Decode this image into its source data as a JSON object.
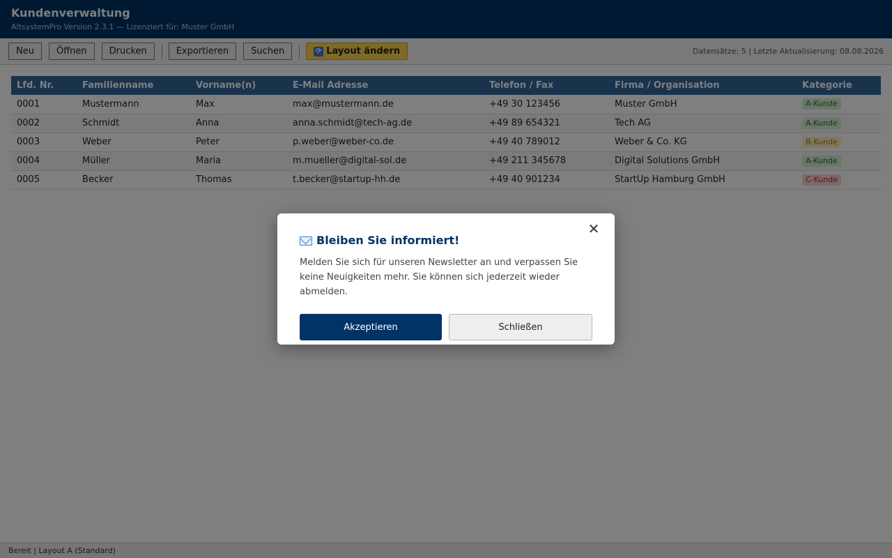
{
  "app": {
    "title": "Kundenverwaltung",
    "subtitle": "AltsystemPro Version 2.3.1 — Lizenziert für: Muster GmbH"
  },
  "toolbar": {
    "new_label": "Neu",
    "open_label": "Öffnen",
    "print_label": "Drucken",
    "export_label": "Exportieren",
    "search_label": "Suchen",
    "layout_label": "Layout ändern",
    "layout_icon": "refresh-icon",
    "info": "Datensätze: 5 | Letzte Aktualisierung: 08.08.2026"
  },
  "table": {
    "headers": [
      "Lfd. Nr.",
      "Familienname",
      "Vorname(n)",
      "E-Mail Adresse",
      "Telefon / Fax",
      "Firma / Organisation",
      "Kategorie"
    ],
    "rows": [
      {
        "nr": "0001",
        "last": "Mustermann",
        "first": "Max",
        "email": "max@mustermann.de",
        "phone": "+49 30 123456",
        "company": "Muster GmbH",
        "category": "A-Kunde"
      },
      {
        "nr": "0002",
        "last": "Schmidt",
        "first": "Anna",
        "email": "anna.schmidt@tech-ag.de",
        "phone": "+49 89 654321",
        "company": "Tech AG",
        "category": "A-Kunde"
      },
      {
        "nr": "0003",
        "last": "Weber",
        "first": "Peter",
        "email": "p.weber@weber-co.de",
        "phone": "+49 40 789012",
        "company": "Weber & Co. KG",
        "category": "B-Kunde"
      },
      {
        "nr": "0004",
        "last": "Müller",
        "first": "Maria",
        "email": "m.mueller@digital-sol.de",
        "phone": "+49 211 345678",
        "company": "Digital Solutions GmbH",
        "category": "A-Kunde"
      },
      {
        "nr": "0005",
        "last": "Becker",
        "first": "Thomas",
        "email": "t.becker@startup-hh.de",
        "phone": "+49 40 901234",
        "company": "StartUp Hamburg GmbH",
        "category": "C-Kunde"
      }
    ]
  },
  "status": {
    "text": "Bereit | Layout A (Standard)"
  },
  "modal": {
    "icon": "mail-icon",
    "title": "Bleiben Sie informiert!",
    "text": "Melden Sie sich für unseren Newsletter an und verpassen Sie keine Neuigkeiten mehr. Sie können sich jederzeit wieder abmelden.",
    "accept_label": "Akzeptieren",
    "close_label": "Schließen",
    "close_icon_glyph": "✕"
  },
  "colors": {
    "header": "#003366",
    "table_header": "#336699",
    "layout_button": "#ffd24d",
    "accept_button": "#003366"
  }
}
